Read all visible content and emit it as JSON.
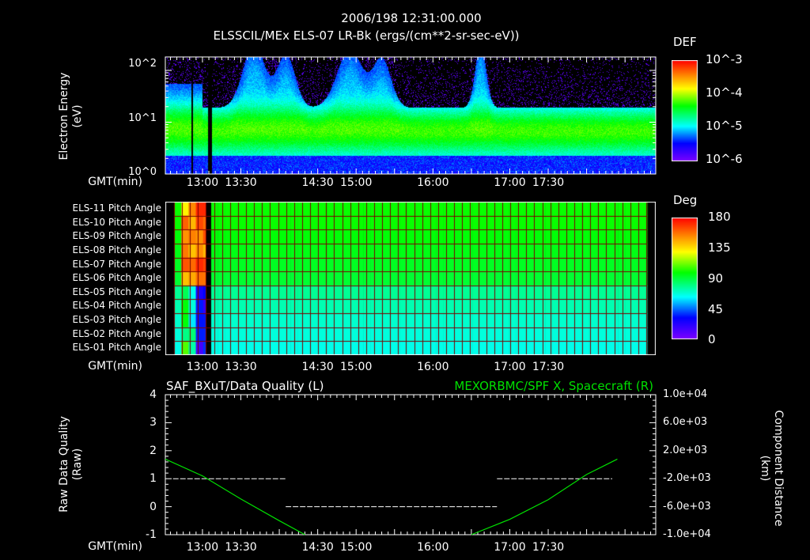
{
  "header": {
    "timestamp": "2006/198 12:31:00.000"
  },
  "colors": {
    "background": "#000000",
    "grid": "#8b0000",
    "curve": "#00e000",
    "quality": "#ffffff"
  },
  "chart_data": [
    {
      "type": "heatmap",
      "title": "ELSSCIL/MEx ELS-07 LR-Bk  (ergs/(cm**2-sr-sec-eV))",
      "ylabel": "Electron Energy\n(eV)",
      "yscale": "log",
      "ylim": [
        1,
        180
      ],
      "yticks": [
        "10^0",
        "10^1",
        "10^2"
      ],
      "xlabel": "GMT(min)",
      "xticks": [
        "13:00",
        "13:30",
        "14:30",
        "15:00",
        "16:00",
        "17:00",
        "17:30"
      ],
      "xrange_min": [
        -29,
        354
      ],
      "colorbar": {
        "label": "DEF",
        "scale": "log",
        "range": [
          1e-06,
          0.001
        ],
        "ticks": [
          "10^-6",
          "10^-5",
          "10^-4",
          "10^-3"
        ]
      }
    },
    {
      "type": "heatmap",
      "title": "Pitch Angle",
      "xlabel": "GMT(min)",
      "xticks": [
        "13:00",
        "13:30",
        "14:30",
        "15:00",
        "16:00",
        "17:00",
        "17:30"
      ],
      "rows": [
        "ELS-11 Pitch Angle",
        "ELS-10 Pitch Angle",
        "ELS-09 Pitch Angle",
        "ELS-08 Pitch Angle",
        "ELS-07 Pitch Angle",
        "ELS-06 Pitch Angle",
        "ELS-05 Pitch Angle",
        "ELS-04 Pitch Angle",
        "ELS-03 Pitch Angle",
        "ELS-02 Pitch Angle",
        "ELS-01 Pitch Angle"
      ],
      "row_values_deg": [
        100,
        100,
        98,
        96,
        94,
        92,
        78,
        74,
        70,
        68,
        66
      ],
      "colorbar": {
        "label": "Deg",
        "range": [
          0,
          180
        ],
        "ticks": [
          "0",
          "45",
          "90",
          "135",
          "180"
        ]
      }
    },
    {
      "type": "line",
      "title_left": "SAF_BXuT/Data Quality (L)",
      "title_right": "MEXORBMC/SPF X, Spacecraft (R)",
      "ylabel_left": "Raw Data Quality\n(Raw)",
      "ylabel_right": "Component Distance\n(km)",
      "ylim_left": [
        -1,
        4
      ],
      "yticks_left": [
        "4",
        "3",
        "2",
        "1",
        "0",
        "-1"
      ],
      "ylim_right": [
        -10000,
        10000
      ],
      "yticks_right": [
        "1.0e+04",
        "6.0e+03",
        "2.0e+03",
        "-2.0e+03",
        "-6.0e+03",
        "-1.0e+04"
      ],
      "xlabel": "GMT(min)",
      "xticks": [
        "13:00",
        "13:30",
        "14:30",
        "15:00",
        "16:00",
        "17:00",
        "17:30"
      ],
      "series": [
        {
          "name": "Data Quality",
          "axis": "left",
          "segments": [
            {
              "from": "12:37",
              "to": "14:05",
              "value": 1
            },
            {
              "from": "14:05",
              "to": "16:50",
              "value": 0
            },
            {
              "from": "16:50",
              "to": "18:20",
              "value": 1
            }
          ]
        },
        {
          "name": "SPF X",
          "axis": "right",
          "x": [
            "12:31",
            "13:00",
            "13:30",
            "14:00",
            "14:20",
            "16:30",
            "17:00",
            "17:30",
            "18:00",
            "18:24"
          ],
          "y": [
            800,
            -1600,
            -4900,
            -8000,
            -10000,
            -10000,
            -7800,
            -5000,
            -1400,
            800
          ]
        }
      ]
    }
  ]
}
